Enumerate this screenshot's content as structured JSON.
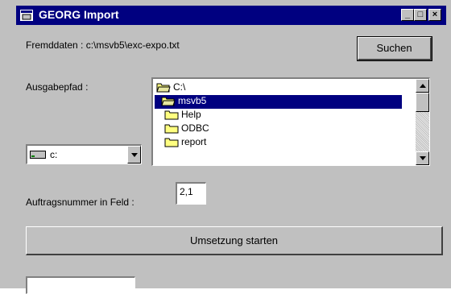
{
  "window": {
    "title": "GEORG Import",
    "minimize_glyph": "_",
    "maximize_glyph": "□",
    "close_glyph": "×"
  },
  "source": {
    "label": "Fremddaten : c:\\msvb5\\exc-expo.txt",
    "search_button": "Suchen"
  },
  "output": {
    "label": "Ausgabepfad :",
    "drive": "c:",
    "folders": [
      {
        "name": "C:\\",
        "icon": "folder-open-icon",
        "selected": false
      },
      {
        "name": "msvb5",
        "icon": "folder-open-icon",
        "selected": true
      },
      {
        "name": "Help",
        "icon": "folder-icon",
        "selected": false
      },
      {
        "name": "ODBC",
        "icon": "folder-icon",
        "selected": false
      },
      {
        "name": "report",
        "icon": "folder-icon",
        "selected": false
      }
    ]
  },
  "order": {
    "label": "Auftragsnummer in Feld :",
    "value": "2,1"
  },
  "actions": {
    "start_button": "Umsetzung starten"
  },
  "colors": {
    "titlebar": "#000080",
    "face": "#c0c0c0",
    "selection": "#000080"
  }
}
